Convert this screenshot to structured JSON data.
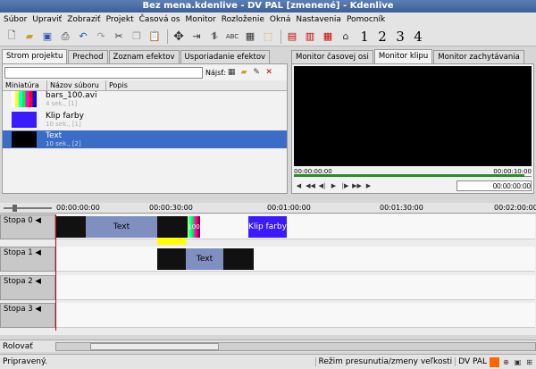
{
  "window": {
    "title": "Bez mena.kdenlive - DV PAL [zmenené] - Kdenlive"
  },
  "menu": [
    "Súbor",
    "Upraviť",
    "Zobraziť",
    "Projekt",
    "Časová os",
    "Monitor",
    "Rozloženie",
    "Okná",
    "Nastavenia",
    "Pomocník"
  ],
  "toolbar": {
    "nums": [
      "1",
      "2",
      "3",
      "4"
    ]
  },
  "leftTabs": [
    "Strom projektu",
    "Prechod",
    "Zoznam efektov",
    "Usporiadanie efektov"
  ],
  "search": {
    "label": "Nájsť:",
    "value": ""
  },
  "columns": [
    "Miniatúra",
    "Názov súboru",
    "Popis"
  ],
  "items": [
    {
      "name": "bars_100.avi",
      "sub": "4 sek., [1]"
    },
    {
      "name": "Klip farby",
      "sub": "10 sek., [1]"
    },
    {
      "name": "Text",
      "sub": "10 sek., [2]"
    }
  ],
  "rightTabs": [
    "Monitor časovej osi",
    "Monitor klipu",
    "Monitor zachytávania"
  ],
  "monitor": {
    "timecode": "00:00:00:00",
    "ruler_start": "00:00:00:00",
    "ruler_end": "00:00:10:00"
  },
  "timeline": {
    "ruler": [
      "00:00:00:00",
      "00:00:30:00",
      "00:01:00:00",
      "00:01:30:00",
      "00:02:00:00"
    ],
    "tracks": [
      "Stopa 0",
      "Stopa 1",
      "Stopa 2",
      "Stopa 3"
    ],
    "clips": {
      "t0_text": "Text",
      "t0_bars": "100",
      "t0_color": "Klip farby",
      "t1_text": "Text"
    }
  },
  "scroll": {
    "label": "Rolovať"
  },
  "status": {
    "left": "Pripravený.",
    "mode": "Režim presunutia/zmeny veľkosti",
    "profile": "DV PAL"
  },
  "colors": {
    "selection": "#3a6cc8",
    "clipText": "#7f8fbf",
    "clipColor": "#3a1aff",
    "transition": "#ffff00"
  }
}
